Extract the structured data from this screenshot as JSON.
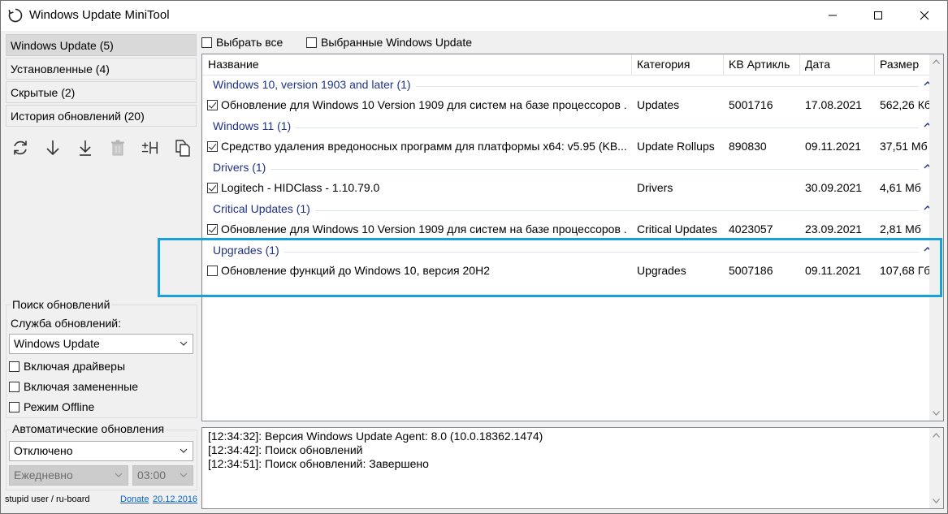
{
  "window": {
    "title": "Windows Update MiniTool"
  },
  "nav": {
    "items": [
      {
        "label": "Windows Update (5)"
      },
      {
        "label": "Установленные (4)"
      },
      {
        "label": "Скрытые (2)"
      },
      {
        "label": "История обновлений (20)"
      }
    ]
  },
  "toolbar": {
    "icons": [
      "refresh-icon",
      "download-icon",
      "install-icon",
      "delete-icon",
      "hide-icon",
      "copy-icon"
    ]
  },
  "top_checks": {
    "select_all": "Выбрать все",
    "selected_updates": "Выбранные Windows Update"
  },
  "list": {
    "columns": [
      "Название",
      "Категория",
      "KB Артикль",
      "Дата",
      "Размер"
    ],
    "groups": [
      {
        "title": "Windows 10, version 1903 and later (1)",
        "rows": [
          {
            "checked": true,
            "name": "Обновление для Windows 10 Version 1909 для систем на базе процессоров ...",
            "category": "Updates",
            "kb": "5001716",
            "date": "17.08.2021",
            "size": "562,26 Кб"
          }
        ]
      },
      {
        "title": "Windows 11 (1)",
        "rows": [
          {
            "checked": true,
            "name": "Средство удаления вредоносных программ для платформы x64: v5.95 (KB...",
            "category": "Update Rollups",
            "kb": "890830",
            "date": "09.11.2021",
            "size": "37,51 Мб"
          }
        ]
      },
      {
        "title": "Drivers (1)",
        "rows": [
          {
            "checked": true,
            "name": "Logitech - HIDClass - 1.10.79.0",
            "category": "Drivers",
            "kb": "",
            "date": "30.09.2021",
            "size": "4,61 Мб"
          }
        ]
      },
      {
        "title": "Critical Updates (1)",
        "rows": [
          {
            "checked": true,
            "name": "Обновление для Windows 10 Version 1909 для систем на базе процессоров ...",
            "category": "Critical Updates",
            "kb": "4023057",
            "date": "23.09.2021",
            "size": "2,81 Мб"
          }
        ]
      },
      {
        "title": "Upgrades (1)",
        "rows": [
          {
            "checked": false,
            "name": "Обновление функций до Windows 10, версия 20H2",
            "category": "Upgrades",
            "kb": "5007186",
            "date": "09.11.2021",
            "size": "107,68 Гб"
          }
        ]
      }
    ]
  },
  "search": {
    "group_title": "Поиск обновлений",
    "service_label": "Служба обновлений:",
    "service_value": "Windows Update",
    "include_drivers": "Включая драйверы",
    "include_superseded": "Включая замененные",
    "offline_mode": "Режим Offline"
  },
  "auto": {
    "group_title": "Автоматические обновления",
    "mode_value": "Отключено",
    "frequency_value": "Ежедневно",
    "time_value": "03:00"
  },
  "footer": {
    "credit": "stupid user / ru-board",
    "donate": "Donate",
    "date_link": "20.12.2016"
  },
  "log": {
    "lines": [
      "[12:34:32]: Версия Windows Update Agent: 8.0 (10.0.18362.1474)",
      "[12:34:42]: Поиск обновлений",
      "[12:34:51]: Поиск обновлений: Завершено"
    ]
  },
  "colors": {
    "group_title": "#1e3287",
    "highlight": "#1aa0d8",
    "link": "#0b62c4"
  }
}
